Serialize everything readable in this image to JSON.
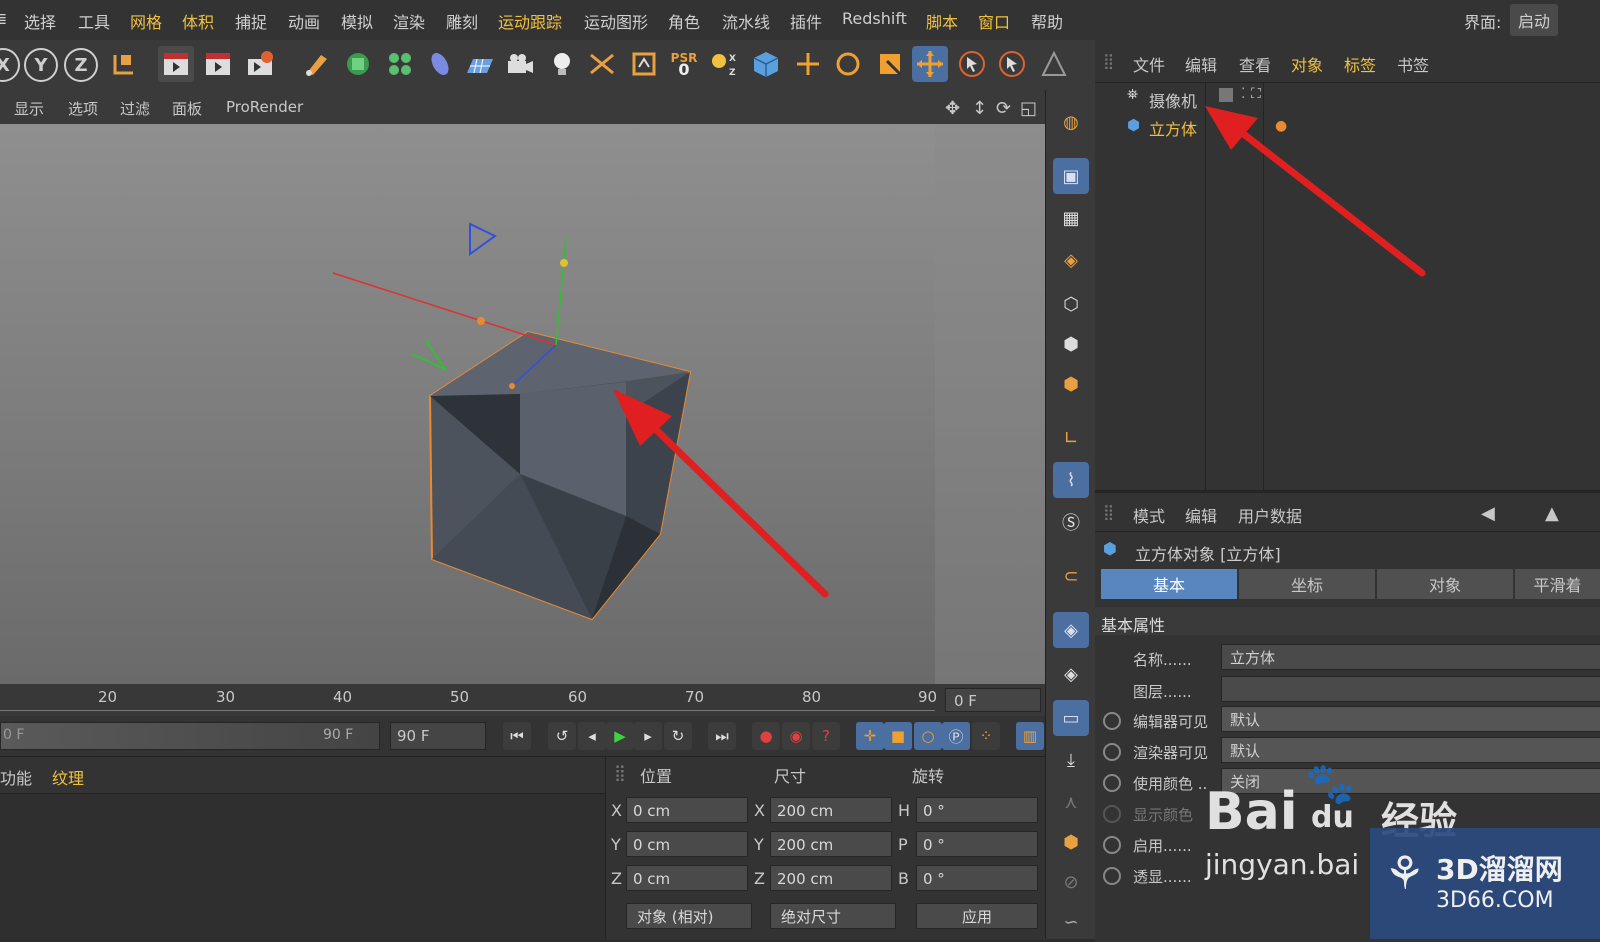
{
  "menubar": {
    "items": [
      "选择",
      "工具",
      "网格",
      "体积",
      "捕捉",
      "动画",
      "模拟",
      "渲染",
      "雕刻",
      "运动跟踪",
      "运动图形",
      "角色",
      "流水线",
      "插件",
      "Redshift",
      "脚本",
      "窗口",
      "帮助"
    ],
    "layout_label": "界面:",
    "layout_value": "启动"
  },
  "toolbar": {
    "axis_buttons": [
      "X",
      "Y",
      "Z"
    ],
    "psr_label": "PSR",
    "psr_value": "0"
  },
  "viewport": {
    "menu": [
      "显示",
      "选项",
      "过滤",
      "面板",
      "ProRender"
    ]
  },
  "object_manager": {
    "menu": [
      "文件",
      "编辑",
      "查看",
      "对象",
      "标签",
      "书签"
    ],
    "objects": [
      {
        "name": "摄像机",
        "type": "camera"
      },
      {
        "name": "立方体",
        "type": "cube"
      }
    ]
  },
  "attribute_manager": {
    "menu": [
      "模式",
      "编辑",
      "用户数据"
    ],
    "object_title": "立方体对象 [立方体]",
    "tabs": [
      "基本",
      "坐标",
      "对象",
      "平滑着"
    ],
    "active_tab": "基本",
    "section": "基本属性",
    "props": [
      {
        "label": "名称",
        "value": "立方体"
      },
      {
        "label": "图层",
        "value": ""
      },
      {
        "label": "编辑器可见",
        "value": "默认"
      },
      {
        "label": "渲染器可见",
        "value": "默认"
      },
      {
        "label": "使用颜色",
        "value": "关闭"
      },
      {
        "label": "显示颜色",
        "value": ""
      },
      {
        "label": "启用",
        "value": ""
      },
      {
        "label": "透显",
        "value": ""
      }
    ]
  },
  "timeline": {
    "ticks": [
      "20",
      "30",
      "40",
      "50",
      "60",
      "70",
      "80",
      "90"
    ],
    "current_frame": "0 F",
    "range_start": "0 F",
    "range_end_slider": "90 F",
    "range_end": "90 F"
  },
  "material_panel": {
    "menu": [
      "功能",
      "纹理"
    ]
  },
  "coordinates": {
    "headers": [
      "位置",
      "尺寸",
      "旋转"
    ],
    "rows": [
      {
        "axis": "X",
        "pos": "0 cm",
        "size_axis": "X",
        "size": "200 cm",
        "rot_axis": "H",
        "rot": "0 °"
      },
      {
        "axis": "Y",
        "pos": "0 cm",
        "size_axis": "Y",
        "size": "200 cm",
        "rot_axis": "P",
        "rot": "0 °"
      },
      {
        "axis": "Z",
        "pos": "0 cm",
        "size_axis": "Z",
        "size": "200 cm",
        "rot_axis": "B",
        "rot": "0 °"
      }
    ],
    "mode_dropdown": "对象 (相对)",
    "size_dropdown": "绝对尺寸",
    "apply_button": "应用"
  },
  "watermarks": {
    "baidu": "Bai",
    "baidu_du": "du",
    "baidu_jingyan": "经验",
    "baidu_url": "jingyan.bai",
    "site_name": "3D溜溜网",
    "site_url": "3D66.COM"
  },
  "colors": {
    "accent_blue": "#5a86c0",
    "highlight_yellow": "#f0c040",
    "arrow_red": "#e02020",
    "cube_outline": "#e88a30"
  }
}
